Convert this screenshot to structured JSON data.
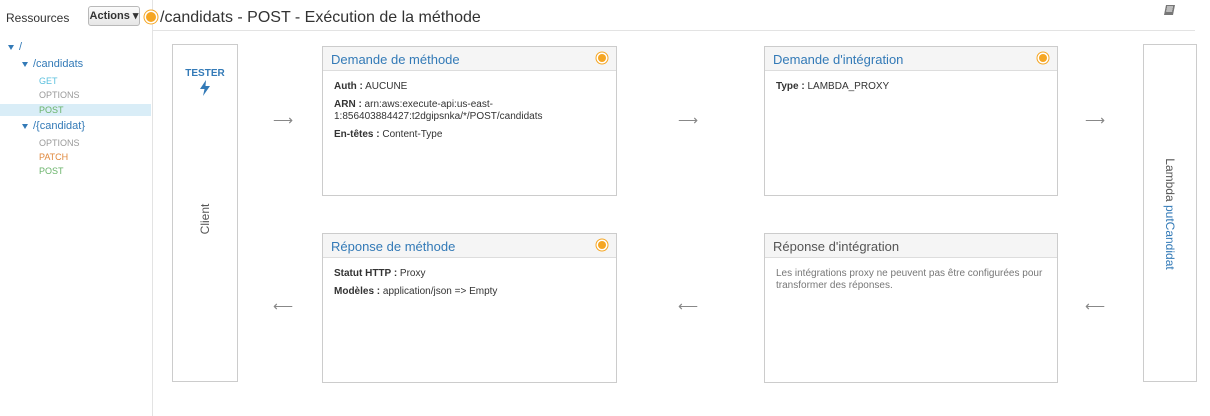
{
  "sidebar": {
    "resources_label": "Ressources",
    "actions_label": "Actions ▾",
    "tree": {
      "root": "/",
      "candidats": "/candidats",
      "candidats_methods": [
        "GET",
        "OPTIONS",
        "POST"
      ],
      "candidat": "/{candidat}",
      "candidat_methods": [
        "OPTIONS",
        "PATCH",
        "POST"
      ]
    }
  },
  "header": {
    "title": "/candidats - POST - Exécution de la méthode"
  },
  "client": {
    "tester": "TESTER",
    "label": "Client"
  },
  "lambda": {
    "prefix": "Lambda ",
    "link": "putCandidat"
  },
  "cards": {
    "method_request": {
      "title": "Demande de méthode",
      "auth_key": "Auth :",
      "auth_val": " AUCUNE",
      "arn_key": "ARN :",
      "arn_val": " arn:aws:execute-api:us-east-1:856403884427:t2dgipsnka/*/POST/candidats",
      "headers_key": "En-têtes :",
      "headers_val": " Content-Type"
    },
    "integration_request": {
      "title": "Demande d'intégration",
      "type_key": "Type :",
      "type_val": " LAMBDA_PROXY"
    },
    "method_response": {
      "title": "Réponse de méthode",
      "status_key": "Statut HTTP :",
      "status_val": " Proxy",
      "models_key": "Modèles :",
      "models_val": " application/json => Empty"
    },
    "integration_response": {
      "title": "Réponse d'intégration",
      "note": "Les intégrations proxy ne peuvent pas être configurées pour transformer des réponses."
    }
  },
  "arrows": {
    "right": "⟶",
    "left": "⟵"
  },
  "colors": {
    "link_blue": "#337ab7",
    "accent_orange": "#f5a623",
    "post_green": "#69b36a",
    "patch_orange": "#e0883c",
    "selected_bg": "#d9edf7"
  }
}
